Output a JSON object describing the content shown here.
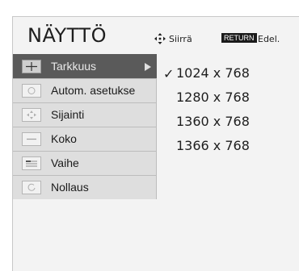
{
  "header": {
    "title": "NÄYTTÖ",
    "move_hint": "Siirrä",
    "return_badge": "RETURN",
    "back_hint": "Edel."
  },
  "menu": {
    "items": [
      {
        "label": "Tarkkuus",
        "icon": "resolution-icon",
        "selected": true
      },
      {
        "label": "Autom. asetukse",
        "icon": "auto-config-icon",
        "selected": false
      },
      {
        "label": "Sijainti",
        "icon": "position-icon",
        "selected": false
      },
      {
        "label": "Koko",
        "icon": "size-icon",
        "selected": false
      },
      {
        "label": "Vaihe",
        "icon": "phase-icon",
        "selected": false
      },
      {
        "label": "Nollaus",
        "icon": "reset-icon",
        "selected": false
      }
    ]
  },
  "resolutions": {
    "selected": "1024 x 768",
    "options": [
      "1024 x 768",
      "1280 x 768",
      "1360 x 768",
      "1366 x 768"
    ]
  }
}
